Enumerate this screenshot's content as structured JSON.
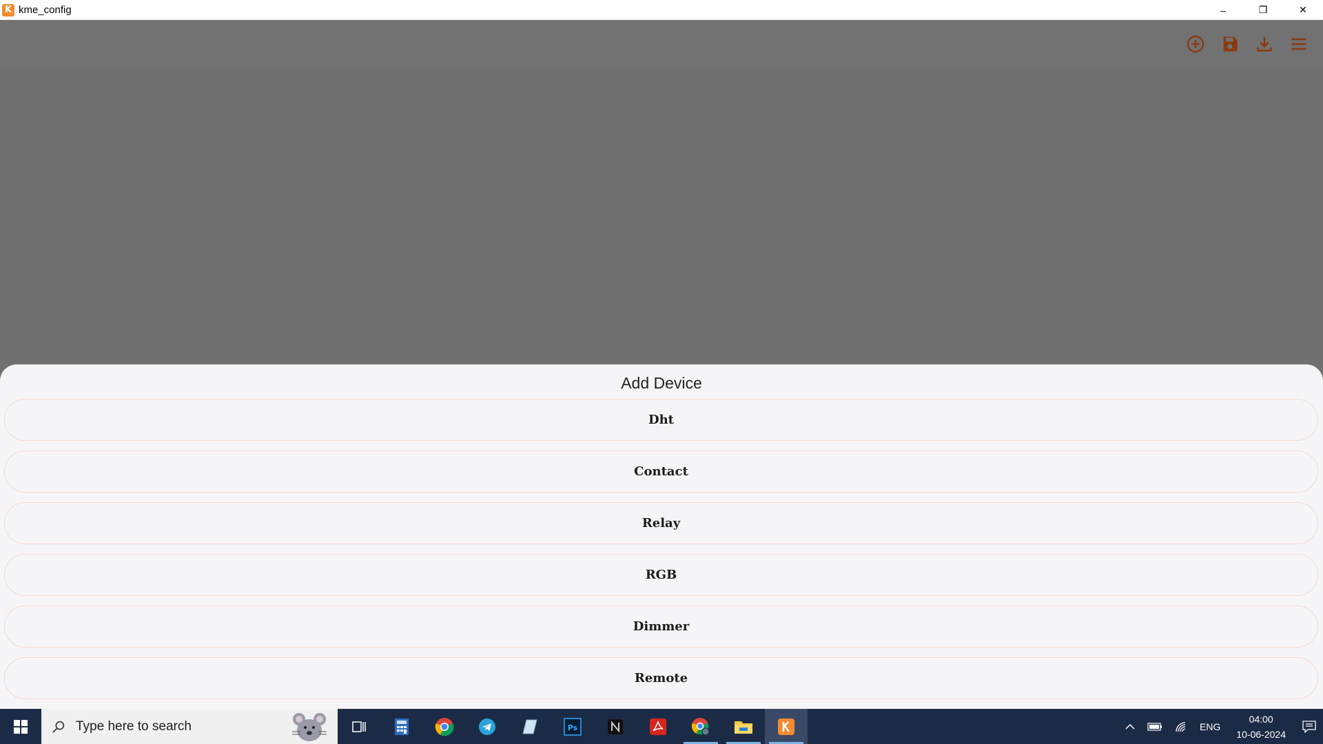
{
  "window": {
    "app_icon_letter": "K",
    "title": "kme_config",
    "controls": {
      "minimize": "–",
      "restore": "❐",
      "close": "✕"
    }
  },
  "appbar": {
    "actions": [
      "add-circle-icon",
      "save-icon",
      "download-icon",
      "menu-icon"
    ],
    "icon_color": "#8a3a10"
  },
  "sheet": {
    "title": "Add Device",
    "devices": [
      "Dht",
      "Contact",
      "Relay",
      "RGB",
      "Dimmer",
      "Remote"
    ],
    "border_color": "#f1d8cd"
  },
  "taskbar": {
    "search_placeholder": "Type here to search",
    "pinned": [
      "task-view-icon",
      "calculator-icon",
      "chrome-icon",
      "telegram-icon",
      "notes-icon",
      "photoshop-icon",
      "notion-icon",
      "acrobat-icon",
      "chrome-profile-icon",
      "file-explorer-icon",
      "kme-config-icon"
    ],
    "tray": {
      "language": "ENG",
      "time": "04:00",
      "date": "10-06-2024"
    }
  }
}
